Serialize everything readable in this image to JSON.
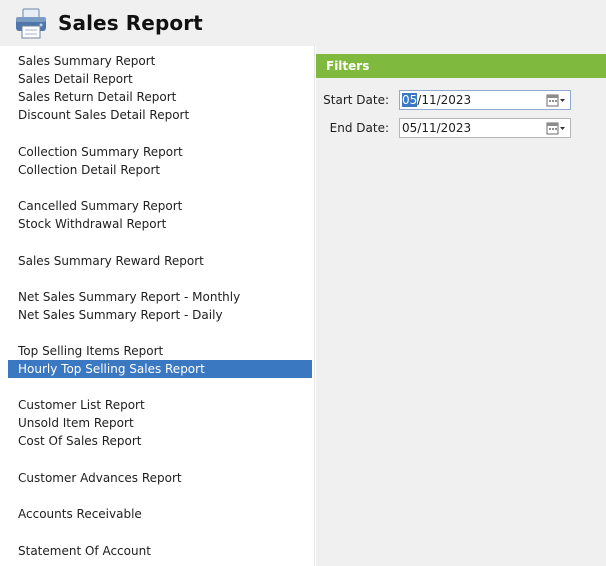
{
  "app": {
    "title": "Sales Report",
    "icon": "printer-icon"
  },
  "reports": [
    {
      "label": "Sales Summary Report"
    },
    {
      "label": "Sales Detail Report"
    },
    {
      "label": "Sales Return Detail Report"
    },
    {
      "label": "Discount Sales Detail Report"
    },
    {
      "label": "Collection Summary Report"
    },
    {
      "label": "Collection Detail Report"
    },
    {
      "label": "Cancelled Summary Report"
    },
    {
      "label": "Stock Withdrawal Report"
    },
    {
      "label": "Sales Summary Reward Report"
    },
    {
      "label": "Net Sales Summary Report - Monthly"
    },
    {
      "label": "Net Sales Summary Report - Daily"
    },
    {
      "label": "Top Selling Items Report"
    },
    {
      "label": "Hourly Top Selling Sales Report",
      "selected": true
    },
    {
      "label": "Customer List Report"
    },
    {
      "label": "Unsold Item Report"
    },
    {
      "label": "Cost Of Sales Report"
    },
    {
      "label": "Customer Advances Report"
    },
    {
      "label": "Accounts Receivable"
    },
    {
      "label": "Statement Of Account"
    }
  ],
  "filters": {
    "header": "Filters",
    "start_date": {
      "label": "Start Date:",
      "value_highlight": "05",
      "value_rest": "/11/2023"
    },
    "end_date": {
      "label": "End Date:",
      "value": "05/11/2023"
    }
  },
  "colors": {
    "filters_header": "#7fba3f",
    "selection": "#3a78c2",
    "panel_bg": "#f0f0f0"
  }
}
